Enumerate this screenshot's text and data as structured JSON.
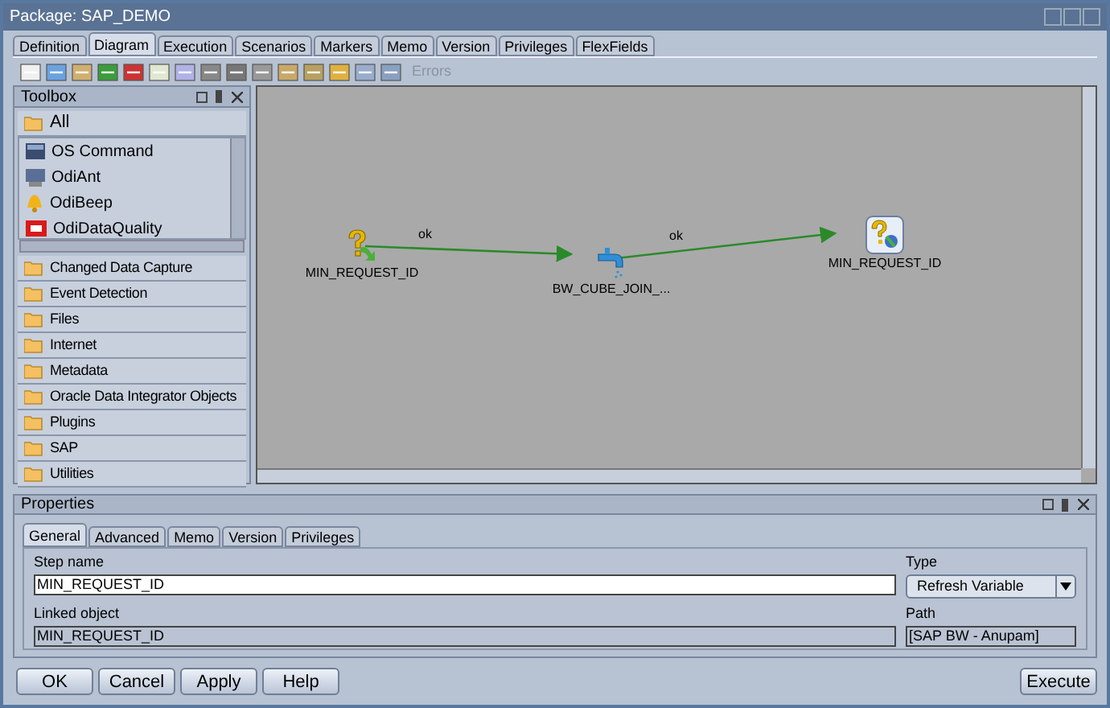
{
  "window": {
    "title": "Package: SAP_DEMO"
  },
  "tabs": [
    {
      "label": "Definition",
      "selected": false
    },
    {
      "label": "Diagram",
      "selected": true
    },
    {
      "label": "Execution",
      "selected": false
    },
    {
      "label": "Scenarios",
      "selected": false
    },
    {
      "label": "Markers",
      "selected": false
    },
    {
      "label": "Memo",
      "selected": false
    },
    {
      "label": "Version",
      "selected": false
    },
    {
      "label": "Privileges",
      "selected": false
    },
    {
      "label": "FlexFields",
      "selected": false
    }
  ],
  "toolbar": {
    "errors": {
      "label": "Errors",
      "disabled": true
    }
  },
  "toolbox": {
    "title": "Toolbox",
    "open_group": "All",
    "items": [
      {
        "label": "OS Command"
      },
      {
        "label": "OdiAnt"
      },
      {
        "label": "OdiBeep"
      },
      {
        "label": "OdiDataQuality"
      }
    ],
    "groups": [
      "Changed Data Capture",
      "Event Detection",
      "Files",
      "Internet",
      "Metadata",
      "Oracle Data Integrator Objects",
      "Plugins",
      "SAP",
      "Utilities"
    ]
  },
  "diagram": {
    "nodes": [
      {
        "kind": "variable",
        "label": "MIN_REQUEST_ID"
      },
      {
        "kind": "interface",
        "label": "BW_CUBE_JOIN_..."
      },
      {
        "kind": "refresh",
        "label": "MIN_REQUEST_ID"
      }
    ],
    "links": [
      {
        "label": "ok"
      },
      {
        "label": "ok"
      }
    ]
  },
  "properties": {
    "title": "Properties",
    "tabs": [
      {
        "label": "General",
        "selected": true
      },
      {
        "label": "Advanced",
        "selected": false
      },
      {
        "label": "Memo",
        "selected": false
      },
      {
        "label": "Version",
        "selected": false
      },
      {
        "label": "Privileges",
        "selected": false
      }
    ],
    "step_name": {
      "label": "Step name",
      "value": "MIN_REQUEST_ID"
    },
    "type": {
      "label": "Type",
      "value": "Refresh Variable"
    },
    "linked_object": {
      "label": "Linked object",
      "value": "MIN_REQUEST_ID"
    },
    "path": {
      "label": "Path",
      "value": "[SAP BW - Anupam]"
    }
  },
  "buttons": [
    {
      "label": "OK"
    },
    {
      "label": "Cancel"
    },
    {
      "label": "Apply"
    },
    {
      "label": "Help"
    }
  ],
  "execute_button": {
    "label": "Execute"
  }
}
